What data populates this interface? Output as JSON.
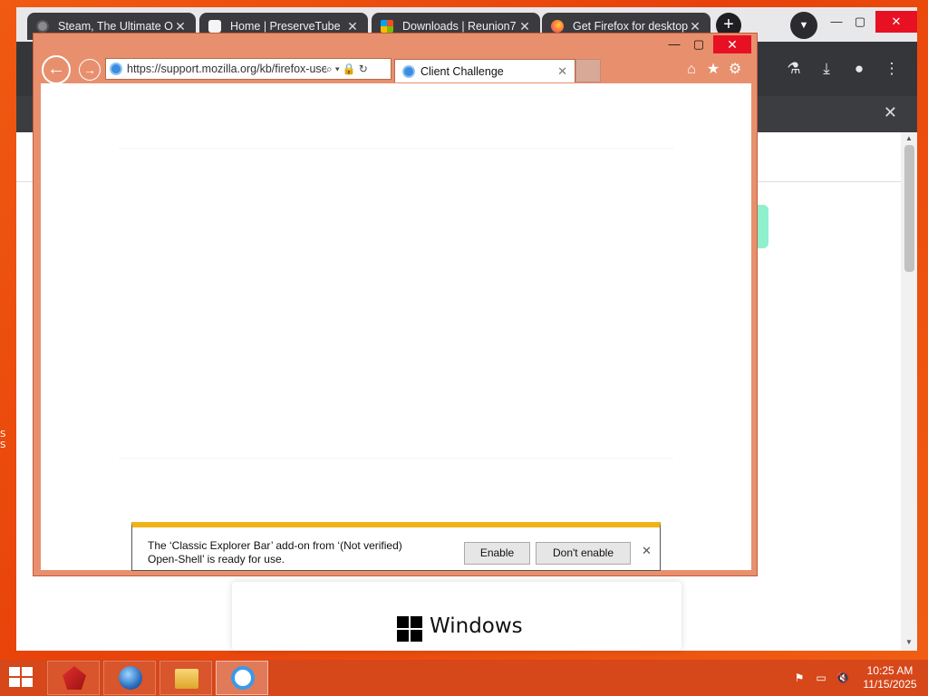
{
  "desktop": {
    "edge_labels": [
      "S",
      "S"
    ]
  },
  "chrome": {
    "tabs": [
      {
        "label": "Steam, The Ultimate O",
        "icon": "steam-icon"
      },
      {
        "label": "Home | PreserveTube",
        "icon": "download-icon"
      },
      {
        "label": "Downloads | Reunion7",
        "icon": "windows-flag-icon"
      },
      {
        "label": "Get Firefox for desktop",
        "icon": "firefox-icon"
      }
    ],
    "new_tab": "+",
    "window_controls": {
      "minimize": "—",
      "maximize": "▢",
      "close": "✕"
    }
  },
  "windows_card": {
    "word": "Windows"
  },
  "ie": {
    "window_controls": {
      "minimize": "—",
      "maximize": "▢",
      "close": "✕"
    },
    "address": "https://support.mozilla.org/kb/firefox-use",
    "tab_title": "Client Challenge",
    "tab_close": "✕"
  },
  "notification": {
    "line1": "The ‘Classic Explorer Bar’ add-on from ‘(Not verified)",
    "line2": "Open-Shell’ is ready for use.",
    "enable_label": "Enable",
    "dont_enable_label": "Don't enable",
    "close": "✕"
  },
  "taskbar": {
    "apps": [
      "start-menu-app",
      "globe-app",
      "file-explorer-app",
      "internet-explorer-app"
    ],
    "time": "10:25 AM",
    "date": "11/15/2025"
  }
}
